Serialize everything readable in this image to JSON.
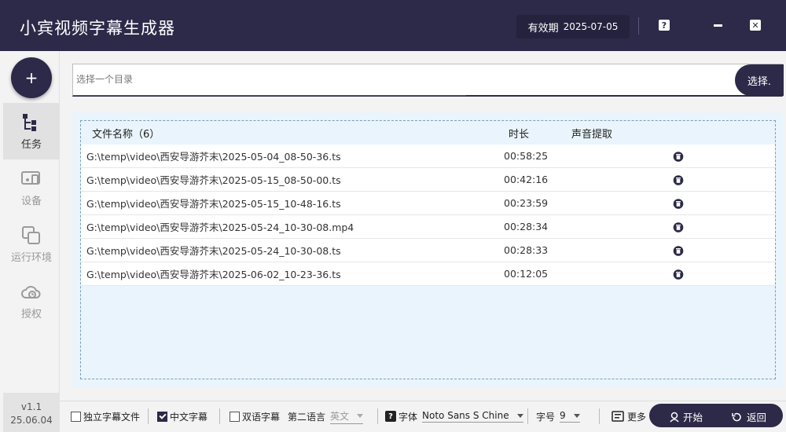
{
  "app": {
    "title": "小宾视频字幕生成器"
  },
  "validity": {
    "label": "有效期",
    "date": "2025-07-05"
  },
  "titlebar": {
    "help": "?",
    "close": "✕"
  },
  "sidebar": {
    "add": "+",
    "items": [
      {
        "label": "任务",
        "icon": "task-tree-icon",
        "active": true
      },
      {
        "label": "设备",
        "icon": "device-icon",
        "active": false
      },
      {
        "label": "运行环境",
        "icon": "environment-icon",
        "active": false
      },
      {
        "label": "授权",
        "icon": "cloud-license-icon",
        "active": false
      }
    ],
    "version": "v1.1",
    "build": "25.06.04"
  },
  "directory": {
    "placeholder": "选择一个目录",
    "value": "",
    "button": "选择."
  },
  "file_list": {
    "header": {
      "name": "文件名称（6）",
      "duration": "时长",
      "audio": "声音提取"
    },
    "rows": [
      {
        "path": "G:\\temp\\video\\西安导游芥末\\2025-05-04_08-50-36.ts",
        "duration": "00:58:25",
        "audio": ""
      },
      {
        "path": "G:\\temp\\video\\西安导游芥末\\2025-05-15_08-50-00.ts",
        "duration": "00:42:16",
        "audio": ""
      },
      {
        "path": "G:\\temp\\video\\西安导游芥末\\2025-05-15_10-48-16.ts",
        "duration": "00:23:59",
        "audio": ""
      },
      {
        "path": "G:\\temp\\video\\西安导游芥末\\2025-05-24_10-30-08.mp4",
        "duration": "00:28:34",
        "audio": ""
      },
      {
        "path": "G:\\temp\\video\\西安导游芥末\\2025-05-24_10-30-08.ts",
        "duration": "00:28:33",
        "audio": ""
      },
      {
        "path": "G:\\temp\\video\\西安导游芥末\\2025-06-02_10-23-36.ts",
        "duration": "00:12:05",
        "audio": ""
      }
    ]
  },
  "bottom": {
    "standalone_sub": {
      "label": "独立字幕文件",
      "checked": false
    },
    "chinese_sub": {
      "label": "中文字幕",
      "checked": true
    },
    "bilingual_sub": {
      "label": "双语字幕",
      "checked": false
    },
    "second_lang_label": "第二语言",
    "second_lang_value": "英文",
    "help": "?",
    "font_label": "字体",
    "font_value": "Noto Sans S Chine",
    "size_label": "字号",
    "size_value": "9",
    "more": "更多",
    "start": "开始",
    "back": "返回"
  },
  "colors": {
    "brand": "#2c2a48",
    "list_bg": "#e9f4fc"
  }
}
